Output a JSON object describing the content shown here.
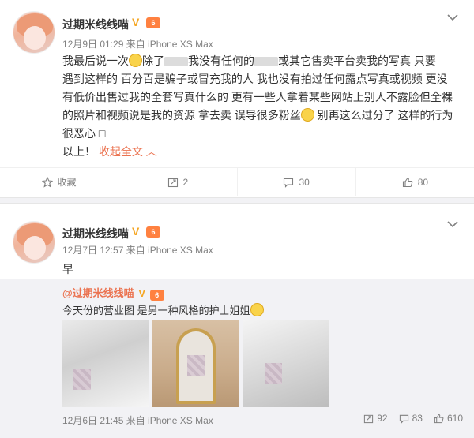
{
  "post1": {
    "author": "过期米线线喵",
    "verified_badge": "V",
    "level_badge": "6",
    "meta": "12月9日 01:29 来自 iPhone XS Max",
    "text_lines": [
      [
        "我最后说一次",
        "除了",
        "我没有任何的",
        "或其它售卖平台卖我的写真  只要"
      ],
      "遇到这样的 百分百是骗子或冒充我的人  我也没有拍过任何露点写真或视频 更没",
      "有低价出售过我的全套写真什么的  更有一些人拿着某些网站上别人不露脸但全裸",
      [
        "的照片和视频说是我的资源 拿去卖 误导很多粉丝",
        " 别再这么过分了 这样的行为"
      ],
      "很恶心 □"
    ],
    "end_text": "以上！",
    "collapse_label": "收起全文",
    "actions": {
      "favorite": "收藏",
      "repost": "2",
      "comment": "30",
      "like": "80"
    }
  },
  "post2": {
    "author": "过期米线线喵",
    "verified_badge": "V",
    "level_badge": "6",
    "meta": "12月7日 12:57 来自 iPhone XS Max",
    "text": "早",
    "repost": {
      "author": "@过期米线线喵",
      "text": "今天份的营业图 是另一种风格的护士姐姐",
      "meta": "12月6日 21:45 来自 iPhone XS Max",
      "reposts": "92",
      "comments": "83",
      "likes": "610"
    }
  },
  "colors": {
    "accent": "#eb7350",
    "muted": "#808080",
    "divider": "#f2f2f5"
  }
}
